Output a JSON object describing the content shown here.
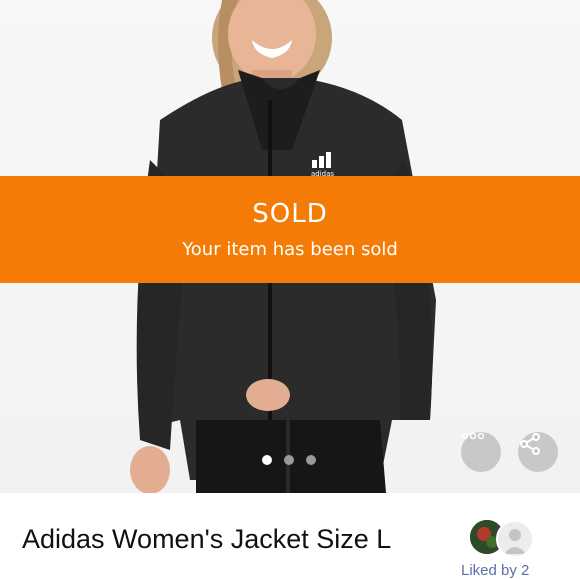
{
  "listing": {
    "banner": {
      "status": "SOLD",
      "message": "Your item has been sold",
      "color": "#f47c06"
    },
    "photo": {
      "brand_mark": "adidas",
      "carousel": {
        "total": 3,
        "current": 1
      }
    },
    "actions": {
      "more_icon": "more-dots-icon",
      "share_icon": "share-icon"
    },
    "title": "Adidas Women's Jacket Size L",
    "likes": {
      "text": "Liked by 2"
    }
  }
}
